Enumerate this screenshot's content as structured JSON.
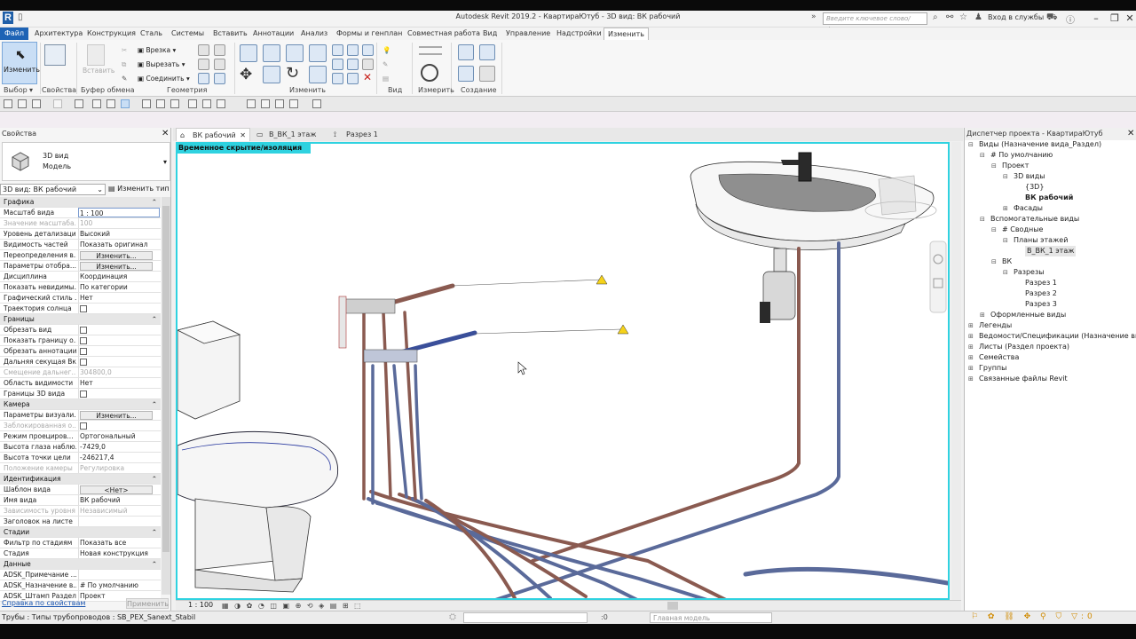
{
  "app": {
    "logo": "R",
    "title": "Autodesk Revit 2019.2 -   КвартираЮтуб - 3D вид: ВК рабочий",
    "search_placeholder": "Введите ключевое слово/фразу",
    "signin": "Вход в службы"
  },
  "menu": [
    "Файл",
    "Архитектура",
    "Конструкция",
    "Сталь",
    "Системы",
    "Вставить",
    "Аннотации",
    "Анализ",
    "Формы и генплан",
    "Совместная работа",
    "Вид",
    "Управление",
    "Надстройки",
    "Изменить"
  ],
  "ribbon": {
    "modify_label": "Изменить",
    "paste_label": "Вставить",
    "clipboard_items": [
      "Врезка",
      "Вырезать",
      "Соединить"
    ],
    "panels": [
      "Выбор",
      "Свойства",
      "Буфер обмена",
      "Геометрия",
      "Изменить",
      "Вид",
      "Измерить",
      "Создание"
    ]
  },
  "properties": {
    "header": "Свойства",
    "type_line1": "3D вид",
    "type_line2": "Модель",
    "view_selector": "3D вид: ВК рабочий",
    "edit_type": "Изменить тип",
    "rows": [
      {
        "k": "Графика",
        "cat": true
      },
      {
        "k": "Масштаб вида",
        "v": "1 : 100"
      },
      {
        "k": "Значение масштаба...",
        "v": "100",
        "grey": true
      },
      {
        "k": "Уровень детализации",
        "v": "Высокий"
      },
      {
        "k": "Видимость частей",
        "v": "Показать оригинал"
      },
      {
        "k": "Переопределения в...",
        "v": "Изменить...",
        "btn": true
      },
      {
        "k": "Параметры отобра...",
        "v": "Изменить...",
        "btn": true
      },
      {
        "k": "Дисциплина",
        "v": "Координация"
      },
      {
        "k": "Показать невидимы...",
        "v": "По категории"
      },
      {
        "k": "Графический стиль ...",
        "v": "Нет"
      },
      {
        "k": "Траектория солнца",
        "v": "",
        "cb": true
      },
      {
        "k": "Границы",
        "cat": true
      },
      {
        "k": "Обрезать вид",
        "v": "",
        "cb": true
      },
      {
        "k": "Показать границу о...",
        "v": "",
        "cb": true
      },
      {
        "k": "Обрезать аннотации",
        "v": "",
        "cb": true
      },
      {
        "k": "Дальняя секущая Вкл",
        "v": "",
        "cb": true
      },
      {
        "k": "Смещение дальнег...",
        "v": "304800,0",
        "grey": true
      },
      {
        "k": "Область видимости",
        "v": "Нет"
      },
      {
        "k": "Границы 3D вида",
        "v": "",
        "cb": true
      },
      {
        "k": "Камера",
        "cat": true
      },
      {
        "k": "Параметры визуали...",
        "v": "Изменить...",
        "btn": true
      },
      {
        "k": "Заблокированная о...",
        "v": "",
        "grey": true,
        "cb": true
      },
      {
        "k": "Режим проециров...",
        "v": "Ортогональный"
      },
      {
        "k": "Высота глаза наблю...",
        "v": "-7429,0"
      },
      {
        "k": "Высота точки цели",
        "v": "-246217,4"
      },
      {
        "k": "Положение камеры",
        "v": "Регулировка",
        "grey": true
      },
      {
        "k": "Идентификация",
        "cat": true
      },
      {
        "k": "Шаблон вида",
        "v": "<Нет>",
        "btn": true
      },
      {
        "k": "Имя вида",
        "v": "ВК рабочий"
      },
      {
        "k": "Зависимость уровня",
        "v": "Независимый",
        "grey": true
      },
      {
        "k": "Заголовок на листе",
        "v": ""
      },
      {
        "k": "Стадии",
        "cat": true
      },
      {
        "k": "Фильтр по стадиям",
        "v": "Показать все"
      },
      {
        "k": "Стадия",
        "v": "Новая конструкция"
      },
      {
        "k": "Данные",
        "cat": true
      },
      {
        "k": "ADSK_Примечание ...",
        "v": ""
      },
      {
        "k": "ADSK_Назначение в...",
        "v": "# По умолчанию"
      },
      {
        "k": "ADSK_Штамп Раздел",
        "v": "Проект"
      }
    ],
    "help_link": "Справка по свойствам",
    "apply": "Применить"
  },
  "tabs": [
    "ВК рабочий",
    "В_ВК_1 этаж",
    "Разрез 1"
  ],
  "viewport": {
    "banner": "Временное скрытие/изоляция",
    "scale": "1 : 100"
  },
  "browser": {
    "header": "Диспетчер проекта - КвартираЮтуб",
    "nodes": [
      {
        "t": "Виды (Назначение вида_Раздел)",
        "lvl": 0,
        "tg": "−"
      },
      {
        "t": "# По умолчанию",
        "lvl": 1,
        "tg": "−"
      },
      {
        "t": "Проект",
        "lvl": 2,
        "tg": "−"
      },
      {
        "t": "3D виды",
        "lvl": 3,
        "tg": "−"
      },
      {
        "t": "{3D}",
        "lvl": 4
      },
      {
        "t": "ВК рабочий",
        "lvl": 4,
        "sel": true
      },
      {
        "t": "Фасады",
        "lvl": 3,
        "tg": "+"
      },
      {
        "t": "Вспомогательные виды",
        "lvl": 1,
        "tg": "−"
      },
      {
        "t": "# Сводные",
        "lvl": 2,
        "tg": "−"
      },
      {
        "t": "Планы этажей",
        "lvl": 3,
        "tg": "−"
      },
      {
        "t": "В_ВК_1 этаж",
        "lvl": 4,
        "hl": true
      },
      {
        "t": "ВК",
        "lvl": 2,
        "tg": "−"
      },
      {
        "t": "Разрезы",
        "lvl": 3,
        "tg": "−"
      },
      {
        "t": "Разрез 1",
        "lvl": 4
      },
      {
        "t": "Разрез 2",
        "lvl": 4
      },
      {
        "t": "Разрез 3",
        "lvl": 4
      },
      {
        "t": "Оформленные виды",
        "lvl": 1,
        "tg": "+"
      },
      {
        "t": "Легенды",
        "lvl": 0,
        "tg": "+"
      },
      {
        "t": "Ведомости/Спецификации (Назначение вида",
        "lvl": 0,
        "tg": "+"
      },
      {
        "t": "Листы (Раздел проекта)",
        "lvl": 0,
        "tg": "+"
      },
      {
        "t": "Семейства",
        "lvl": 0,
        "tg": "+"
      },
      {
        "t": "Группы",
        "lvl": 0,
        "tg": "+"
      },
      {
        "t": "Связанные файлы Revit",
        "lvl": 0,
        "tg": "+"
      }
    ]
  },
  "status": {
    "text": "Трубы : Типы трубопроводов : SB_PEX_Sanext_Stabil",
    "count": ":0",
    "model": "Главная модель"
  },
  "colors": {
    "accent": "#1e63b5",
    "isolation": "#2fd2e0",
    "hot": "#8a5a50",
    "cold": "#5a6a9a"
  }
}
